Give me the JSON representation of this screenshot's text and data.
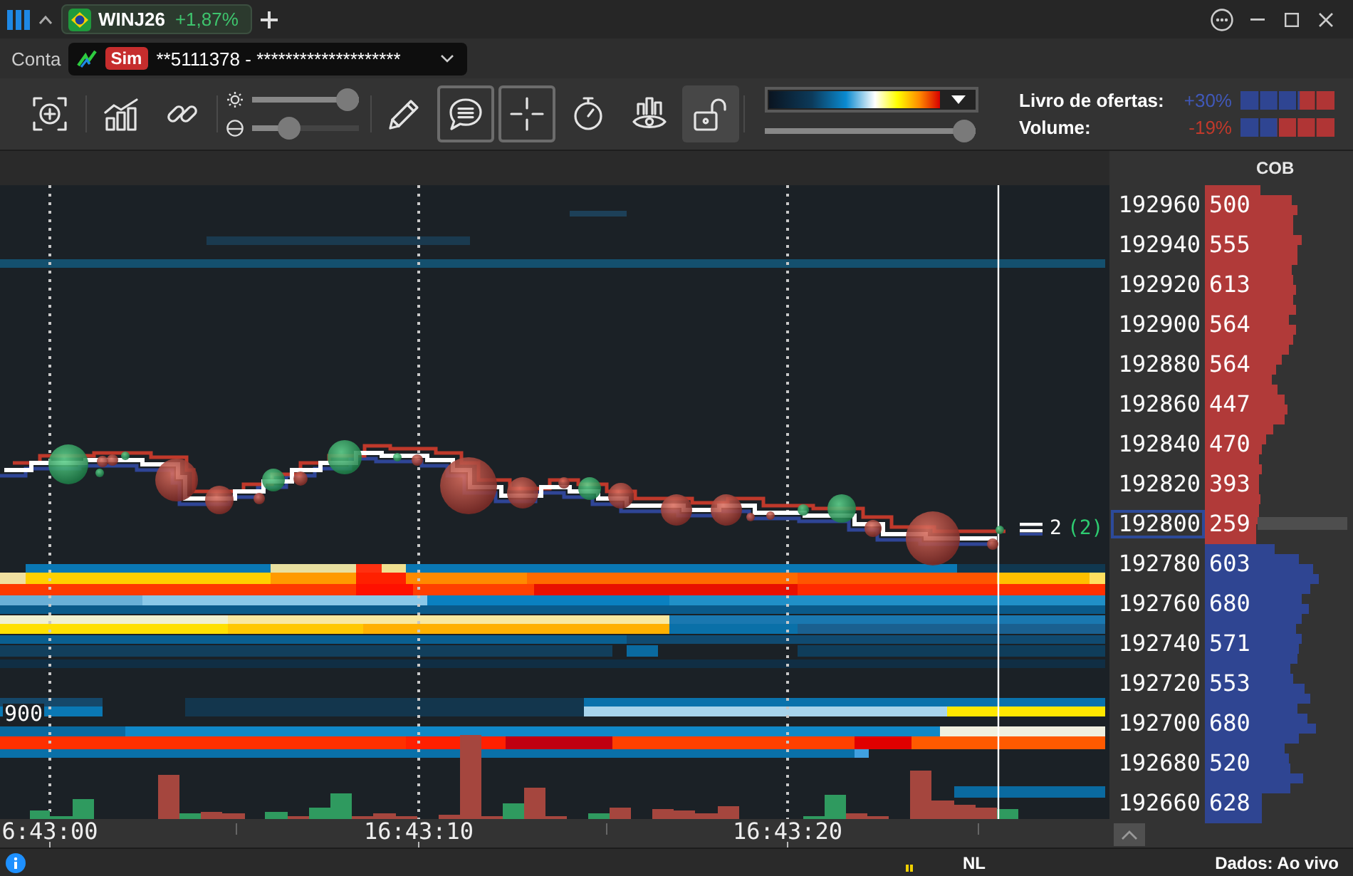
{
  "window": {
    "tabs": [
      {
        "symbol": "WINJ26",
        "change": "+1,87%",
        "selected": true
      }
    ]
  },
  "account": {
    "label": "Conta",
    "mode": "Sim",
    "number": "**5111378 - ********************"
  },
  "toolbar": {
    "tools": [
      {
        "kind": "zoom",
        "on": false,
        "pressed": false
      },
      {
        "kind": "chart",
        "on": false,
        "pressed": false
      },
      {
        "kind": "link",
        "on": false,
        "pressed": false
      },
      {
        "kind": "pencil",
        "on": false,
        "pressed": false
      },
      {
        "kind": "comment",
        "on": true,
        "pressed": false
      },
      {
        "kind": "crosshair",
        "on": true,
        "pressed": false
      },
      {
        "kind": "timer",
        "on": false,
        "pressed": false
      },
      {
        "kind": "eye",
        "on": false,
        "pressed": false
      },
      {
        "kind": "lock",
        "on": false,
        "pressed": true
      }
    ],
    "sliders": [
      {
        "kind": "brightness",
        "level": 1
      },
      {
        "kind": "contrast",
        "level": 0.3
      }
    ],
    "color_scale": {
      "level": 1
    },
    "indicators": [
      {
        "label": "Livro de ofertas:",
        "reading": "+30%",
        "color": "#4058b8",
        "level": 0.63
      },
      {
        "label": "Volume:",
        "reading": "-19%",
        "color": "#c0392b",
        "level": 0.39
      }
    ]
  },
  "chart": {
    "row_label": "900",
    "last_trade": {
      "size": "2",
      "count": "(2)"
    },
    "time_labels": [
      "6:43:00",
      "16:43:10",
      "16:43:20"
    ]
  },
  "ladder": {
    "header": "COB",
    "sides": [
      {
        "color": "#b13a39",
        "rows": [
          {
            "price": "192960",
            "cob": "500",
            "current": false
          },
          {
            "price": "192940",
            "cob": "555",
            "current": false
          },
          {
            "price": "192920",
            "cob": "613",
            "current": false
          },
          {
            "price": "192900",
            "cob": "564",
            "current": false
          },
          {
            "price": "192880",
            "cob": "564",
            "current": false
          },
          {
            "price": "192860",
            "cob": "447",
            "current": false
          },
          {
            "price": "192840",
            "cob": "470",
            "current": false
          },
          {
            "price": "192820",
            "cob": "393",
            "current": false
          },
          {
            "price": "192800",
            "cob": "259",
            "current": true
          }
        ]
      },
      {
        "color": "#2f4592",
        "rows": [
          {
            "price": "192780",
            "cob": "603",
            "current": false
          },
          {
            "price": "192760",
            "cob": "680",
            "current": false
          },
          {
            "price": "192740",
            "cob": "571",
            "current": false
          },
          {
            "price": "192720",
            "cob": "553",
            "current": false
          },
          {
            "price": "192700",
            "cob": "680",
            "current": false
          },
          {
            "price": "192680",
            "cob": "520",
            "current": false
          },
          {
            "price": "192660",
            "cob": "628",
            "current": false
          }
        ]
      }
    ]
  },
  "status_bar": {
    "feed": "NL",
    "data_status": "Dados: Ao vivo"
  }
}
